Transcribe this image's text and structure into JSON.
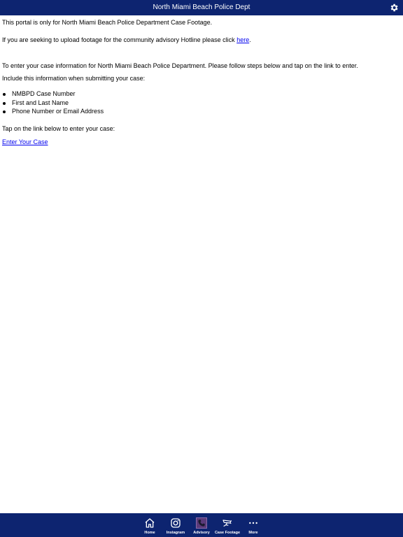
{
  "header": {
    "title": "North Miami Beach Police Dept",
    "settings_icon": "gear-icon"
  },
  "content": {
    "intro": "This portal is only for North Miami Beach Police Department Case Footage.",
    "hotline_text": "If you are seeking to upload footage for the community advisory Hotline please click ",
    "hotline_link": "here",
    "hotline_end": ".",
    "enter_info": "To enter  your case information for North Miami Beach Police Department. Please follow steps below and tap on the link to enter.",
    "include_text": "Include this information when submitting your case:",
    "bullets": [
      "NMBPD Case Number",
      "First and Last Name",
      "Phone Number or Email Address"
    ],
    "tap_text": "Tap on the link below to enter your case:",
    "enter_link": "Enter Your Case"
  },
  "tabbar": {
    "tabs": [
      {
        "label": "Home",
        "icon": "home-icon"
      },
      {
        "label": "Instagram",
        "icon": "instagram-icon"
      },
      {
        "label": "Advisory",
        "icon": "phone-icon"
      },
      {
        "label": "Case Footage",
        "icon": "camera-icon"
      },
      {
        "label": "More",
        "icon": "more-icon"
      }
    ],
    "selected": "Advisory"
  },
  "colors": {
    "bar_background": "#0d2470",
    "link": "#0000ee",
    "advisory_highlight": "#5a3a7a"
  }
}
